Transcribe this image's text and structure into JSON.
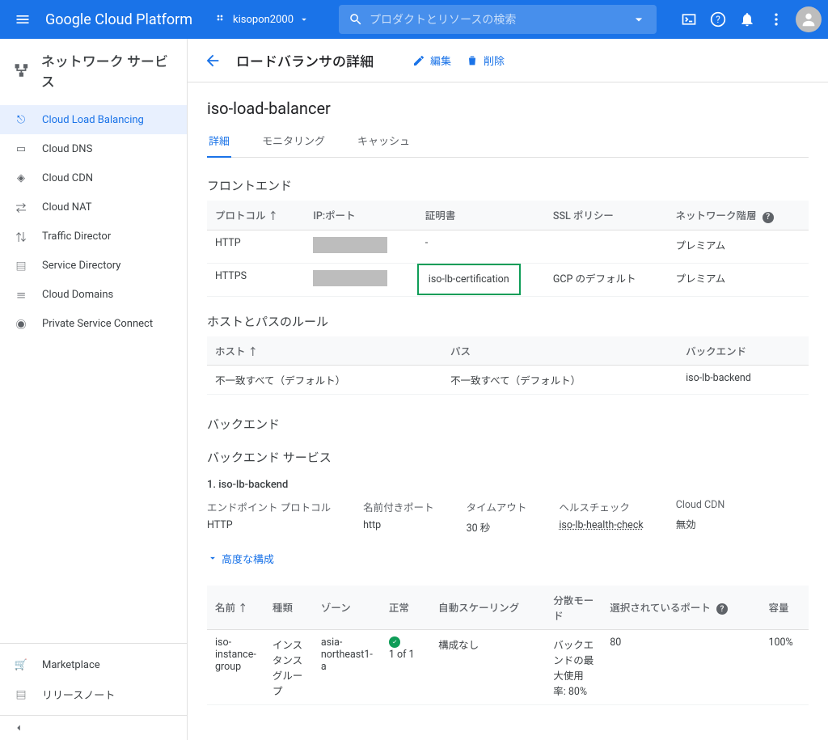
{
  "topbar": {
    "title": "Google Cloud Platform",
    "project": "kisopon2000",
    "search_placeholder": "プロダクトとリソースの検索"
  },
  "sidebar": {
    "section_title": "ネットワーク サービス",
    "items": [
      {
        "label": "Cloud Load Balancing",
        "active": true
      },
      {
        "label": "Cloud DNS"
      },
      {
        "label": "Cloud CDN"
      },
      {
        "label": "Cloud NAT"
      },
      {
        "label": "Traffic Director"
      },
      {
        "label": "Service Directory"
      },
      {
        "label": "Cloud Domains"
      },
      {
        "label": "Private Service Connect"
      }
    ],
    "footer": [
      {
        "label": "Marketplace"
      },
      {
        "label": "リリースノート"
      }
    ]
  },
  "page": {
    "header": "ロードバランサの詳細",
    "edit": "編集",
    "delete": "削除",
    "lb_name": "iso-load-balancer",
    "tabs": [
      "詳細",
      "モニタリング",
      "キャッシュ"
    ]
  },
  "frontend": {
    "title": "フロントエンド",
    "headers": {
      "protocol": "プロトコル",
      "ip": "IP:ポート",
      "cert": "証明書",
      "ssl": "SSL ポリシー",
      "tier": "ネットワーク階層"
    },
    "rows": [
      {
        "protocol": "HTTP",
        "ip": "",
        "cert": "-",
        "ssl": "",
        "tier": "プレミアム"
      },
      {
        "protocol": "HTTPS",
        "ip": "",
        "cert": "iso-lb-certification",
        "ssl": "GCP のデフォルト",
        "tier": "プレミアム"
      }
    ]
  },
  "hostpath": {
    "title": "ホストとパスのルール",
    "headers": {
      "host": "ホスト",
      "path": "パス",
      "backend": "バックエンド"
    },
    "rows": [
      {
        "host": "不一致すべて（デフォルト）",
        "path": "不一致すべて（デフォルト）",
        "backend": "iso-lb-backend"
      }
    ]
  },
  "backend": {
    "title": "バックエンド",
    "service_title": "バックエンド サービス",
    "service_row": "1. iso-lb-backend",
    "labels": {
      "proto": "エンドポイント プロトコル",
      "port": "名前付きポート",
      "timeout": "タイムアウト",
      "health": "ヘルスチェック",
      "cdn": "Cloud CDN"
    },
    "values": {
      "proto": "HTTP",
      "port": "http",
      "timeout": "30 秒",
      "health": "iso-lb-health-check",
      "cdn": "無効"
    },
    "advanced": "高度な構成",
    "tbl_headers": {
      "name": "名前",
      "type": "種類",
      "zone": "ゾーン",
      "healthy": "正常",
      "autoscale": "自動スケーリング",
      "mode": "分散モード",
      "ports": "選択されているポート",
      "cap": "容量"
    },
    "tbl_row": {
      "name": "iso-instance-group",
      "type": "インスタンス グループ",
      "zone": "asia-northeast1-a",
      "healthy": "1 of 1",
      "autoscale": "構成なし",
      "mode": "バックエンドの最大使用率: 80%",
      "ports": "80",
      "cap": "100%"
    }
  }
}
